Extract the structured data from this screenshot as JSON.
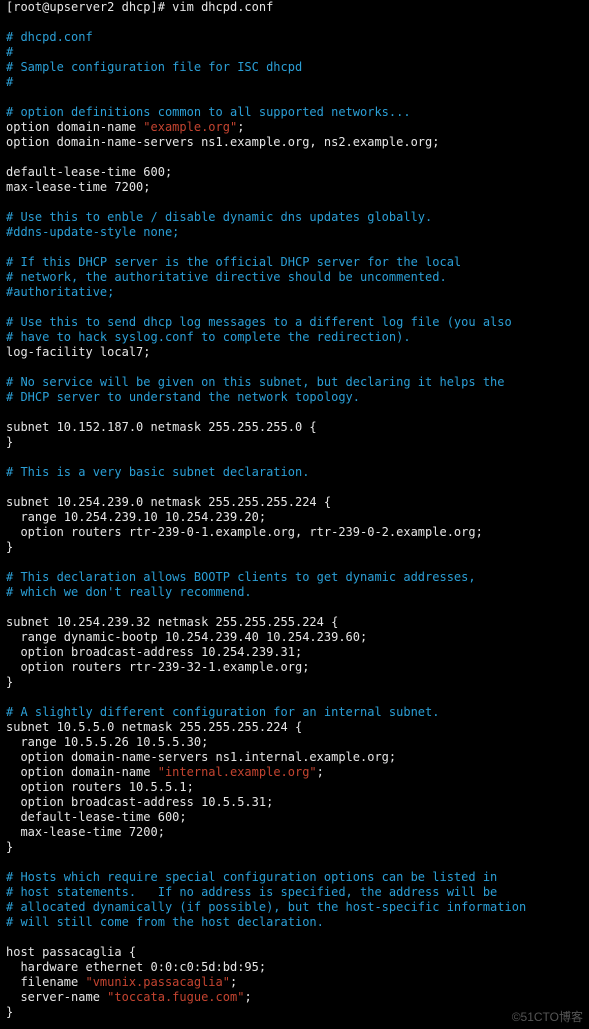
{
  "prompt": {
    "line1_partial": "[root@upserver2 dhcp]# ",
    "cmd1_partial": "",
    "line2": "[root@upserver2 dhcp]# ",
    "cmd2": "vim dhcpd.conf"
  },
  "file": {
    "header": [
      "# dhcpd.conf",
      "#",
      "# Sample configuration file for ISC dhcpd",
      "#"
    ],
    "opt_common_comment": "# option definitions common to all supported networks...",
    "opt_domain_pre": "option domain-name ",
    "opt_domain_str": "\"example.org\"",
    "opt_domain_post": ";",
    "opt_dns": "option domain-name-servers ns1.example.org, ns2.example.org;",
    "default_lease": "default-lease-time 600;",
    "max_lease": "max-lease-time 7200;",
    "ddns_comment1": "# Use this to enble / disable dynamic dns updates globally.",
    "ddns_comment2": "#ddns-update-style none;",
    "auth_c1": "# If this DHCP server is the official DHCP server for the local",
    "auth_c2": "# network, the authoritative directive should be uncommented.",
    "auth_c3": "#authoritative;",
    "log_c1": "# Use this to send dhcp log messages to a different log file (you also",
    "log_c2": "# have to hack syslog.conf to complete the redirection).",
    "log_facility": "log-facility local7;",
    "nosrv_c1": "# No service will be given on this subnet, but declaring it helps the",
    "nosrv_c2": "# DHCP server to understand the network topology.",
    "subnet1_open": "subnet 10.152.187.0 netmask 255.255.255.0 {",
    "close_brace": "}",
    "basic_c": "# This is a very basic subnet declaration.",
    "subnet2_open": "subnet 10.254.239.0 netmask 255.255.255.224 {",
    "subnet2_range": "  range 10.254.239.10 10.254.239.20;",
    "subnet2_routers": "  option routers rtr-239-0-1.example.org, rtr-239-0-2.example.org;",
    "bootp_c1": "# This declaration allows BOOTP clients to get dynamic addresses,",
    "bootp_c2": "# which we don't really recommend.",
    "subnet3_open": "subnet 10.254.239.32 netmask 255.255.255.224 {",
    "subnet3_range": "  range dynamic-bootp 10.254.239.40 10.254.239.60;",
    "subnet3_bcast": "  option broadcast-address 10.254.239.31;",
    "subnet3_routers": "  option routers rtr-239-32-1.example.org;",
    "int_c": "# A slightly different configuration for an internal subnet.",
    "subnet4_open": "subnet 10.5.5.0 netmask 255.255.255.224 {",
    "subnet4_range": "  range 10.5.5.26 10.5.5.30;",
    "subnet4_dns": "  option domain-name-servers ns1.internal.example.org;",
    "subnet4_dom_pre": "  option domain-name ",
    "subnet4_dom_str": "\"internal.example.org\"",
    "subnet4_dom_post": ";",
    "subnet4_routers": "  option routers 10.5.5.1;",
    "subnet4_bcast": "  option broadcast-address 10.5.5.31;",
    "subnet4_dlt": "  default-lease-time 600;",
    "subnet4_mlt": "  max-lease-time 7200;",
    "hosts_c1": "# Hosts which require special configuration options can be listed in",
    "hosts_c2": "# host statements.   If no address is specified, the address will be",
    "hosts_c3": "# allocated dynamically (if possible), but the host-specific information",
    "hosts_c4": "# will still come from the host declaration.",
    "host1_open": "host passacaglia {",
    "host1_hw": "  hardware ethernet 0:0:c0:5d:bd:95;",
    "host1_fn_pre": "  filename ",
    "host1_fn_str": "\"vmunix.passacaglia\"",
    "host1_fn_post": ";",
    "host1_sn_pre": "  server-name ",
    "host1_sn_str": "\"toccata.fugue.com\"",
    "host1_sn_post": ";"
  },
  "watermark": "©51CTO博客"
}
